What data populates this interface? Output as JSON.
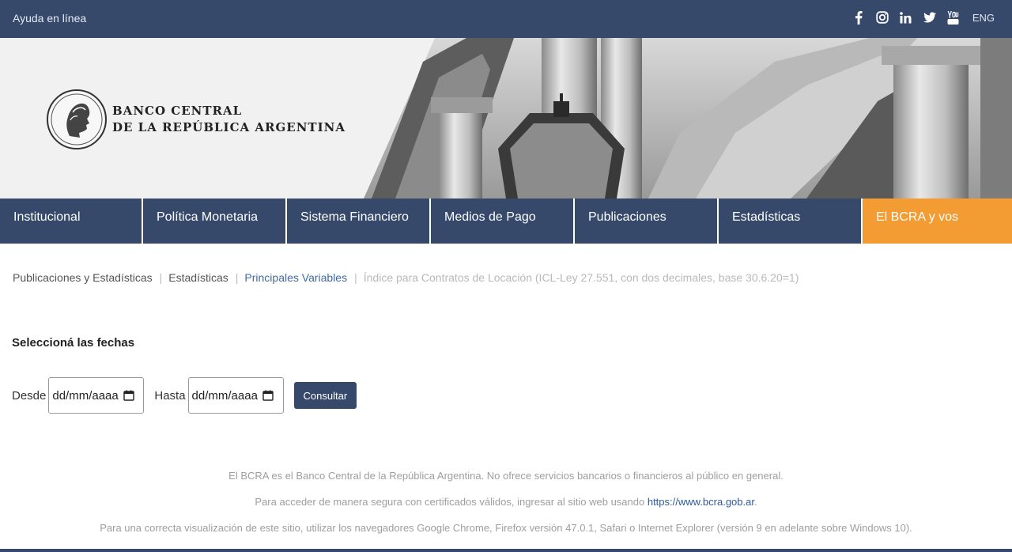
{
  "topbar": {
    "help_label": "Ayuda en línea",
    "social_icons": [
      "facebook-icon",
      "instagram-icon",
      "linkedin-icon",
      "twitter-icon",
      "youtube-icon"
    ],
    "lang_label": "ENG"
  },
  "brand": {
    "line1": "BANCO CENTRAL",
    "line2": "DE LA REPÚBLICA ARGENTINA"
  },
  "nav": {
    "items": [
      {
        "label": "Institucional"
      },
      {
        "label": "Política Monetaria"
      },
      {
        "label": "Sistema Financiero"
      },
      {
        "label": "Medios de Pago"
      },
      {
        "label": "Publicaciones"
      },
      {
        "label": "Estadísticas"
      },
      {
        "label": "El BCRA y vos"
      }
    ]
  },
  "breadcrumb": {
    "items": [
      {
        "label": "Publicaciones y Estadísticas"
      },
      {
        "label": "Estadísticas"
      },
      {
        "label": "Principales Variables"
      },
      {
        "label": "Índice para Contratos de Locación (ICL-Ley 27.551, con dos decimales, base 30.6.20=1)"
      }
    ],
    "separator": "|"
  },
  "form": {
    "title": "Seleccioná las fechas",
    "from_label": "Desde",
    "from_placeholder": "dd/mm/aaaa",
    "to_label": "Hasta",
    "to_placeholder": "dd/mm/aaaa",
    "submit_label": "Consultar"
  },
  "footer": {
    "line1": "El BCRA es el Banco Central de la República Argentina. No ofrece servicios bancarios o financieros al público en general.",
    "line2_prefix": "Para acceder de manera segura con certificados válidos, ingresar al sitio web usando ",
    "line2_link": "https://www.bcra.gob.ar",
    "line2_suffix": ".",
    "line3": "Para una correcta visualización de este sitio, utilizar los navegadores Google Chrome, Firefox versión 47.0.1, Safari o Internet Explorer (versión 9 en adelante sobre Windows 10)."
  },
  "colors": {
    "primary": "#37496b",
    "accent": "#f39c33",
    "link": "#3f6aa3"
  }
}
